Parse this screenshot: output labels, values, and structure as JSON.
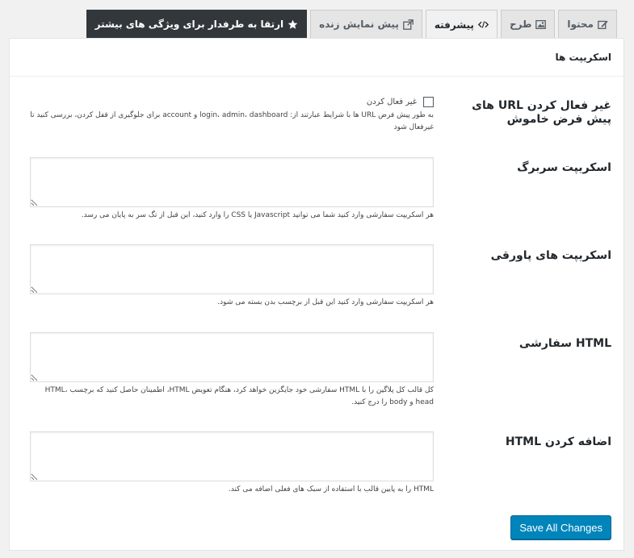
{
  "tabs": [
    {
      "label": "محتوا",
      "icon": "edit-icon"
    },
    {
      "label": "طرح",
      "icon": "image-icon"
    },
    {
      "label": "پیشرفته",
      "icon": "code-icon"
    },
    {
      "label": "پیش نمایش زنده",
      "icon": "external-link-icon"
    },
    {
      "label": "ارتقا به طرفدار برای ویژگی های بیشتر",
      "icon": "star-icon"
    }
  ],
  "panel": {
    "title": "اسکریپت ها"
  },
  "fields": {
    "disable_urls": {
      "label": "غیر فعال کردن URL های پیش فرض خاموش",
      "checkbox_label": "غیر فعال کردن",
      "checked": false,
      "description": "به طور پیش فرض URL ها با شرایط عبارتند از: login، admin، dashboard و account برای جلوگیری از قفل کردن، بررسی کنید تا غیرفعال شود"
    },
    "header_scripts": {
      "label": "اسکریپت سربرگ",
      "value": "",
      "description": "هر اسکریپت سفارشی وارد کنید شما می توانید Javascript یا CSS را وارد کنید، این قبل از تگ سر به پایان می رسد."
    },
    "footer_scripts": {
      "label": "اسکریپت های پاورقی",
      "value": "",
      "description": "هر اسکریپت سفارشی وارد کنید این قبل از برچسب بدن بسته می شود."
    },
    "custom_html": {
      "label": "HTML سفارشی",
      "value": "",
      "description": "کل قالب کل پلاگین را با HTML سفارشی خود جایگزین خواهد کرد، هنگام تعویض HTML، اطمینان حاصل کنید که برچسب HTML، head و body را درج کنید."
    },
    "append_html": {
      "label": "اضافه کردن HTML",
      "value": "",
      "description": "HTML را به پایین قالب با استفاده از سبک های فعلی اضافه می کند."
    }
  },
  "save_button": {
    "label": "Save All Changes"
  },
  "colors": {
    "accent": "#0085ba",
    "upgrade_tab": "#32373c"
  }
}
